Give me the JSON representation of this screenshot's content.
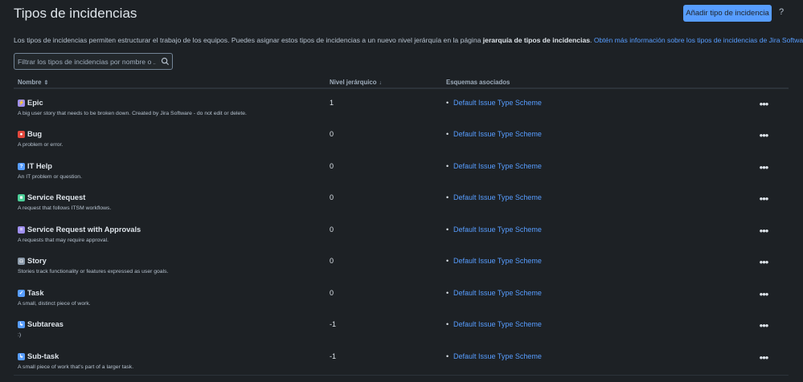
{
  "page": {
    "title": "Tipos de incidencias",
    "add_button": "Añadir tipo de incidencia",
    "help_label": "?",
    "description": {
      "text_before": "Los tipos de incidencias permiten estructurar el trabajo de los equipos. Puedes asignar estos tipos de incidencias a un nuevo nivel jerárquía en la página ",
      "bold_text": "jerarquía de tipos de incidencias",
      "text_after": ". ",
      "link_text": "Obtén más información sobre los tipos de incidencias de Jira Software."
    }
  },
  "search": {
    "placeholder": "Filtrar los tipos de incidencias por nombre o ..."
  },
  "table": {
    "columns": {
      "name": "Nombre",
      "level": "Nivel jerárquico",
      "schemes": "Esquemas asociados"
    },
    "rows": [
      {
        "name": "Epic",
        "description": "A big user story that needs to be broken down. Created by Jira Software - do not edit or delete.",
        "level": "1",
        "scheme": "Default Issue Type Scheme",
        "icon": "epic-icon",
        "icon_color": "#9f8fef",
        "glyph": "⚡"
      },
      {
        "name": "Bug",
        "description": "A problem or error.",
        "level": "0",
        "scheme": "Default Issue Type Scheme",
        "icon": "bug-icon",
        "icon_color": "#e2483d",
        "glyph": "●"
      },
      {
        "name": "IT Help",
        "description": "An IT problem or question.",
        "level": "0",
        "scheme": "Default Issue Type Scheme",
        "icon": "it-help-icon",
        "icon_color": "#579dff",
        "glyph": "?"
      },
      {
        "name": "Service Request",
        "description": "A request that follows ITSM workflows.",
        "level": "0",
        "scheme": "Default Issue Type Scheme",
        "icon": "service-request-icon",
        "icon_color": "#4bce97",
        "glyph": "■"
      },
      {
        "name": "Service Request with Approvals",
        "description": "A requests that may require approval.",
        "level": "0",
        "scheme": "Default Issue Type Scheme",
        "icon": "service-request-approvals-icon",
        "icon_color": "#9f8fef",
        "glyph": "≡"
      },
      {
        "name": "Story",
        "description": "Stories track functionality or features expressed as user goals.",
        "level": "0",
        "scheme": "Default Issue Type Scheme",
        "icon": "story-icon",
        "icon_color": "#8c9bab",
        "glyph": "◘"
      },
      {
        "name": "Task",
        "description": "A small, distinct piece of work.",
        "level": "0",
        "scheme": "Default Issue Type Scheme",
        "icon": "task-icon",
        "icon_color": "#579dff",
        "glyph": "✓"
      },
      {
        "name": "Subtareas",
        "description": ":)",
        "level": "-1",
        "scheme": "Default Issue Type Scheme",
        "icon": "subtask-icon",
        "icon_color": "#579dff",
        "glyph": "↳"
      },
      {
        "name": "Sub-task",
        "description": "A small piece of work that's part of a larger task.",
        "level": "-1",
        "scheme": "Default Issue Type Scheme",
        "icon": "subtask-icon",
        "icon_color": "#579dff",
        "glyph": "↳"
      }
    ]
  },
  "colors": {
    "background": "#1d2125",
    "accent": "#579dff",
    "text": "#b6c2cf"
  }
}
